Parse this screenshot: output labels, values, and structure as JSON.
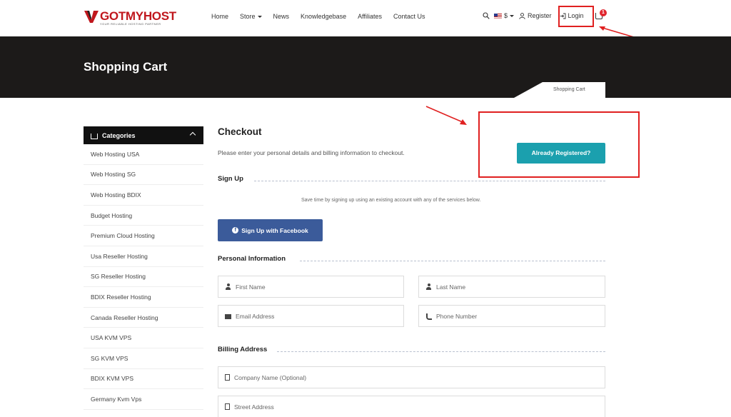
{
  "brand": {
    "logo_text": "GOTMYHOST",
    "tagline": "YOUR RELIABLE HOSTING PARTNER"
  },
  "nav": {
    "items": [
      "Home",
      "Store",
      "News",
      "Knowledgebase",
      "Affiliates",
      "Contact Us"
    ]
  },
  "tools": {
    "currency": "$",
    "register": "Register",
    "login": "Login",
    "cart_count": "1"
  },
  "banner": {
    "title": "Shopping Cart",
    "breadcrumb": "Shopping Cart"
  },
  "sidebar": {
    "heading": "Categories",
    "items": [
      "Web Hosting USA",
      "Web Hosting SG",
      "Web Hosting BDIX",
      "Budget Hosting",
      "Premium Cloud Hosting",
      "Usa Reseller Hosting",
      "SG Reseller Hosting",
      "BDIX Reseller Hosting",
      "Canada Reseller Hosting",
      "USA KVM VPS",
      "SG KVM VPS",
      "BDIX KVM VPS",
      "Germany Kvm Vps"
    ]
  },
  "checkout": {
    "title": "Checkout",
    "intro": "Please enter your personal details and billing information to checkout.",
    "already_registered": "Already Registered?",
    "signup": {
      "title": "Sign Up",
      "note": "Save time by signing up using an existing account with any of the services below.",
      "facebook_button": "Sign Up with Facebook"
    },
    "personal": {
      "title": "Personal Information",
      "first_name": "First Name",
      "last_name": "Last Name",
      "email": "Email Address",
      "phone": "Phone Number"
    },
    "billing": {
      "title": "Billing Address",
      "company": "Company Name (Optional)",
      "street": "Street Address"
    }
  },
  "colors": {
    "brand_red": "#c0171d",
    "banner_bg": "#1c1a19",
    "accent_teal": "#1ba0ae",
    "facebook_blue": "#3b5b9a",
    "annotation_red": "#e02020"
  }
}
